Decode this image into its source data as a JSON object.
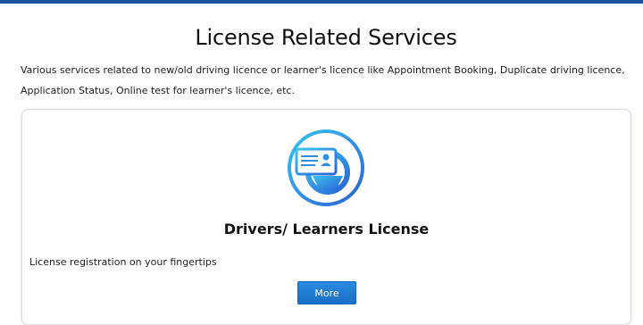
{
  "header": {
    "accent_color": "#1d4fa0"
  },
  "page": {
    "title": "License Related Services",
    "description": "Various services related to new/old driving licence or learner's licence like Appointment Booking, Duplicate driving licence, Application Status, Online test for learner's licence, etc."
  },
  "card": {
    "icon": "license-steering-wheel-icon",
    "title": "Drivers/ Learners License",
    "description": "License registration on your fingertips",
    "button_label": "More",
    "button_color": "#1a6fc9"
  }
}
